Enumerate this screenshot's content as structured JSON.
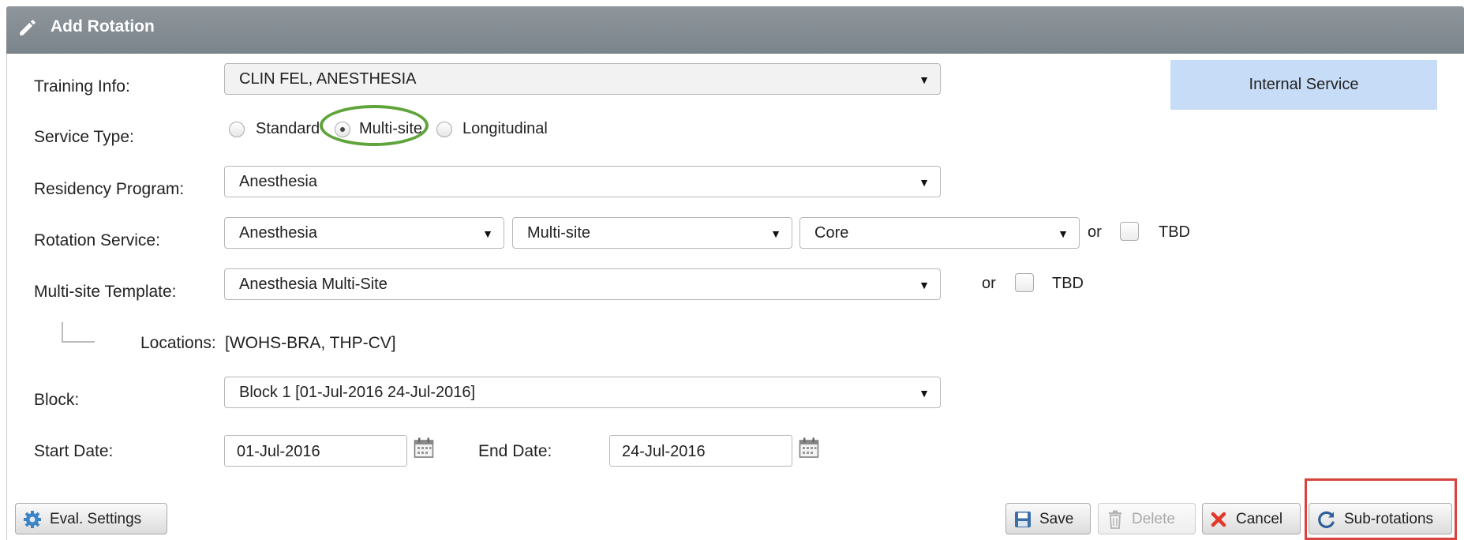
{
  "header": {
    "title": "Add Rotation",
    "icon": "pencil-icon"
  },
  "badge": {
    "internal_service": "Internal Service"
  },
  "form": {
    "training_info": {
      "label": "Training Info:",
      "value": "CLIN FEL, ANESTHESIA"
    },
    "service_type": {
      "label": "Service Type:",
      "options": [
        "Standard",
        "Multi-site",
        "Longitudinal"
      ],
      "selected": "Multi-site"
    },
    "residency_program": {
      "label": "Residency Program:",
      "value": "Anesthesia"
    },
    "rotation_service": {
      "label": "Rotation Service:",
      "service": "Anesthesia",
      "type": "Multi-site",
      "subtype": "Core",
      "or_text": "or",
      "tbd_label": "TBD"
    },
    "multisite_template": {
      "label": "Multi-site Template:",
      "value": "Anesthesia Multi-Site",
      "or_text": "or",
      "tbd_label": "TBD"
    },
    "locations": {
      "label": "Locations:",
      "value": "[WOHS-BRA, THP-CV]"
    },
    "block": {
      "label": "Block:",
      "value": "Block 1 [01-Jul-2016 24-Jul-2016]"
    },
    "start_date": {
      "label": "Start Date:",
      "value": "01-Jul-2016"
    },
    "end_date": {
      "label": "End Date:",
      "value": "24-Jul-2016"
    }
  },
  "footer": {
    "eval_settings": "Eval. Settings",
    "save": "Save",
    "delete": "Delete",
    "cancel": "Cancel",
    "sub_rotations": "Sub-rotations"
  },
  "colors": {
    "header_bg": "#838b91",
    "badge_bg": "#c7dcf7",
    "highlight_ring": "#5ea43a",
    "highlight_frame": "#d9433e"
  }
}
